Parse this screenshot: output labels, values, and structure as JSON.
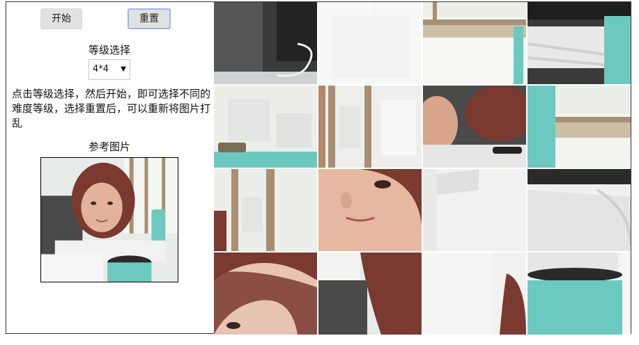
{
  "controls": {
    "start_label": "开始",
    "reset_label": "重置",
    "level_label": "等级选择",
    "level_selected": "4*4",
    "description": "点击等级选择，然后开始，即可选择不同的难度等级，选择重置后，可以重新将图片打乱",
    "reference_label": "参考图片"
  },
  "puzzle": {
    "rows": 4,
    "cols": 4
  },
  "colors": {
    "button_bg": "#e1e1e1",
    "focus_border": "#9bb7e6",
    "teal": "#6cc9c0",
    "hair": "#7a3a30",
    "skin": "#d9a48c",
    "window": "#eef1ee"
  }
}
